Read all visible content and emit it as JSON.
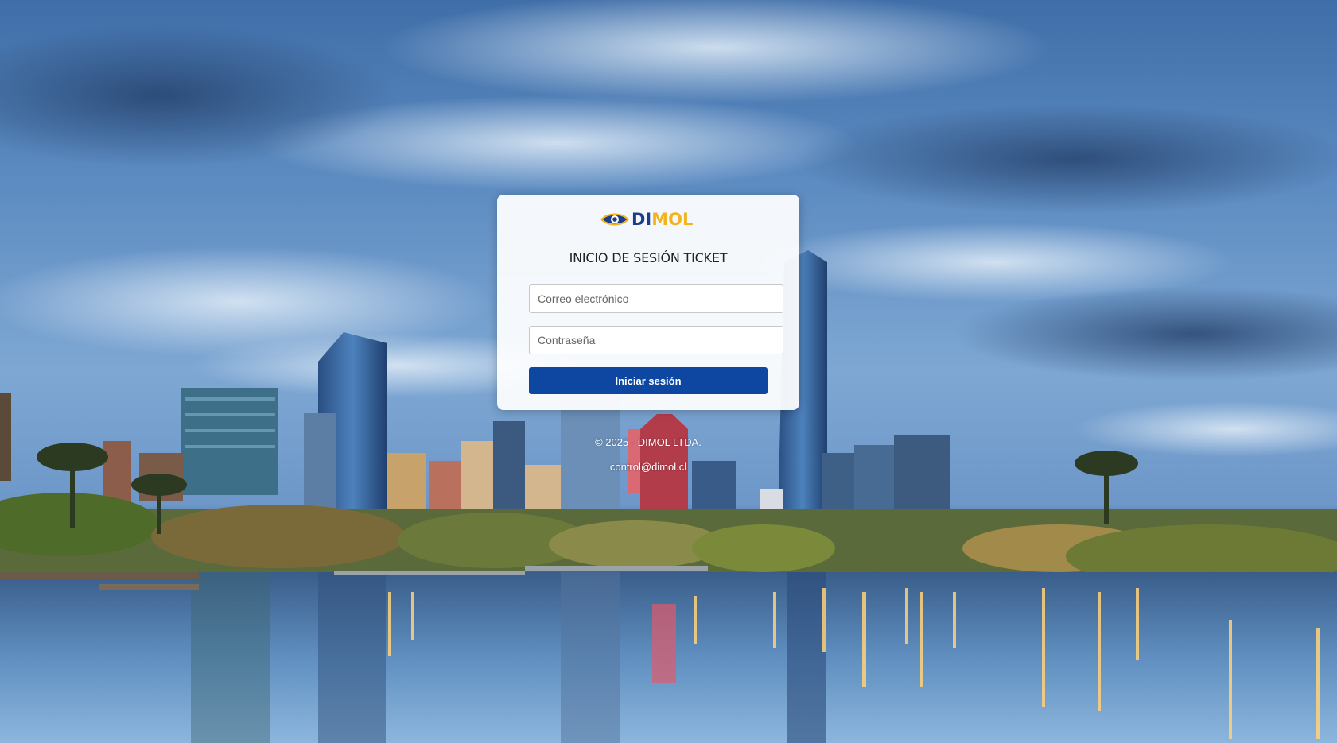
{
  "background": {
    "scene": "city-skyline-at-dusk-with-lake-reflection"
  },
  "login": {
    "logo": {
      "icon": "eye-logo-icon",
      "text_part1": "DI",
      "text_part2": "MOL",
      "color_part1": "#1a3e8c",
      "color_part2": "#f2b41c"
    },
    "title": "INICIO DE SESIÓN TICKET",
    "email_placeholder": "Correo electrónico",
    "email_value": "",
    "password_placeholder": "Contraseña",
    "password_value": "",
    "submit_label": "Iniciar sesión",
    "accent_color": "#0d47a1"
  },
  "footer": {
    "copyright": "© 2025 - DIMOL LTDA.",
    "email": "control@dimol.cl"
  }
}
